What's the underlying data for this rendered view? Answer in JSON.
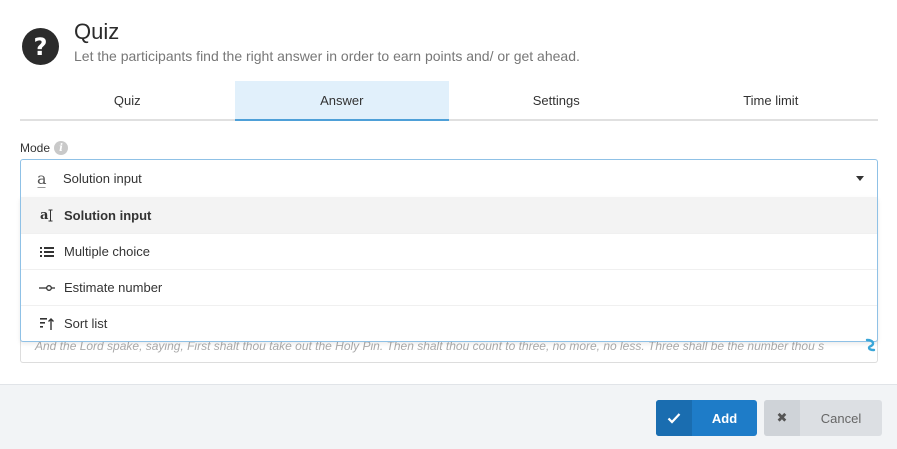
{
  "header": {
    "icon": "question-mark-icon",
    "icon_glyph": "?",
    "title": "Quiz",
    "subtitle": "Let the participants find the right answer in order to earn points and/ or get ahead."
  },
  "tabs": [
    {
      "label": "Quiz",
      "active": false
    },
    {
      "label": "Answer",
      "active": true
    },
    {
      "label": "Settings",
      "active": false
    },
    {
      "label": "Time limit",
      "active": false
    }
  ],
  "mode": {
    "label": "Mode",
    "info_icon": "info-icon",
    "info_glyph": "i",
    "selected_icon_glyph": "a̲",
    "selected": "Solution input",
    "options": [
      {
        "label": "Solution input",
        "icon": "text-cursor-icon"
      },
      {
        "label": "Multiple choice",
        "icon": "list-icon"
      },
      {
        "label": "Estimate number",
        "icon": "slider-icon"
      },
      {
        "label": "Sort list",
        "icon": "sort-list-icon"
      }
    ]
  },
  "textarea": {
    "value": "And the Lord spake, saying, First shalt thou take out the Holy Pin. Then shalt thou count to three, no more, no less. Three shall be the number thou s"
  },
  "footer": {
    "add_label": "Add",
    "cancel_label": "Cancel",
    "cancel_glyph": "✖"
  },
  "colors": {
    "accent": "#1e7cc8",
    "tab_active_bg": "#e1f0fb"
  }
}
